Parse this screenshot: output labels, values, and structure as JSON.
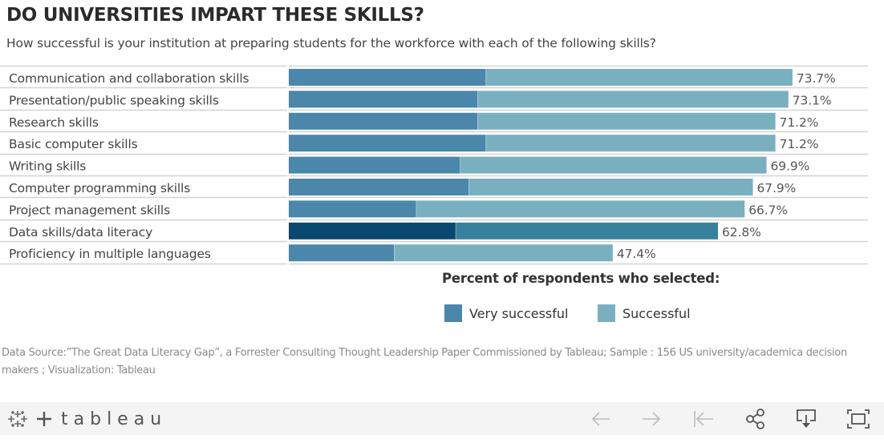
{
  "header": {
    "title": "DO UNIVERSITIES IMPART THESE SKILLS?",
    "subtitle": "How successful is your institution at preparing students for the workforce with each of the following skills?"
  },
  "legend": {
    "title": "Percent of respondents who selected:",
    "items": [
      {
        "label": "Very successful",
        "color": "#4a87aa"
      },
      {
        "label": "Successful",
        "color": "#79b0c0"
      }
    ]
  },
  "source_note": "Data Source:”The Great Data Literacy Gap”, a Forrester Consulting Thought Leadership Paper Commissioned by Tableau; Sample : 156 US university/academica decision makers ;  Visualization: Tableau",
  "colors": {
    "very_successful": "#4a87aa",
    "successful": "#79b0c0",
    "highlight_very_successful": "#0b4870",
    "highlight_successful": "#38819c",
    "row_divider": "#d4d4d4",
    "label_text": "#444444",
    "value_text": "#555555"
  },
  "toolbar": {
    "brand": "tableau",
    "buttons": [
      {
        "name": "undo-button",
        "icon": "arrow-left-icon",
        "enabled": false
      },
      {
        "name": "redo-button",
        "icon": "arrow-right-icon",
        "enabled": false
      },
      {
        "name": "revert-button",
        "icon": "revert-icon",
        "enabled": false
      },
      {
        "name": "share-button",
        "icon": "share-icon",
        "enabled": true
      },
      {
        "name": "download-button",
        "icon": "download-icon",
        "enabled": true
      },
      {
        "name": "fullscreen-button",
        "icon": "fullscreen-icon",
        "enabled": true
      }
    ]
  },
  "chart_data": {
    "type": "bar",
    "orientation": "horizontal",
    "stacked": true,
    "title": "DO UNIVERSITIES IMPART THESE SKILLS?",
    "subtitle": "How successful is your institution at preparing students for the workforce with each of the following skills?",
    "xlabel": "Percent of respondents who selected:",
    "ylabel": "",
    "xlim": [
      0,
      100
    ],
    "grid": false,
    "legend_position": "bottom",
    "highlighted_category": "Data skills/data literacy",
    "categories": [
      "Communication and collaboration skills",
      "Presentation/public speaking skills",
      "Research skills",
      "Basic computer skills",
      "Writing skills",
      "Computer programming skills",
      "Project management skills",
      "Data skills/data literacy",
      "Proficiency in multiple languages"
    ],
    "series": [
      {
        "name": "Very successful",
        "values": [
          28.8,
          27.6,
          27.6,
          28.8,
          25.0,
          26.3,
          18.6,
          24.4,
          15.4
        ]
      },
      {
        "name": "Successful",
        "values": [
          44.9,
          45.5,
          43.6,
          42.4,
          44.9,
          41.6,
          48.1,
          38.4,
          32.0
        ]
      }
    ],
    "totals": [
      73.7,
      73.1,
      71.2,
      71.2,
      69.9,
      67.9,
      66.7,
      62.8,
      47.4
    ],
    "total_labels": [
      "73.7%",
      "73.1%",
      "71.2%",
      "71.2%",
      "69.9%",
      "67.9%",
      "66.7%",
      "62.8%",
      "47.4%"
    ]
  }
}
